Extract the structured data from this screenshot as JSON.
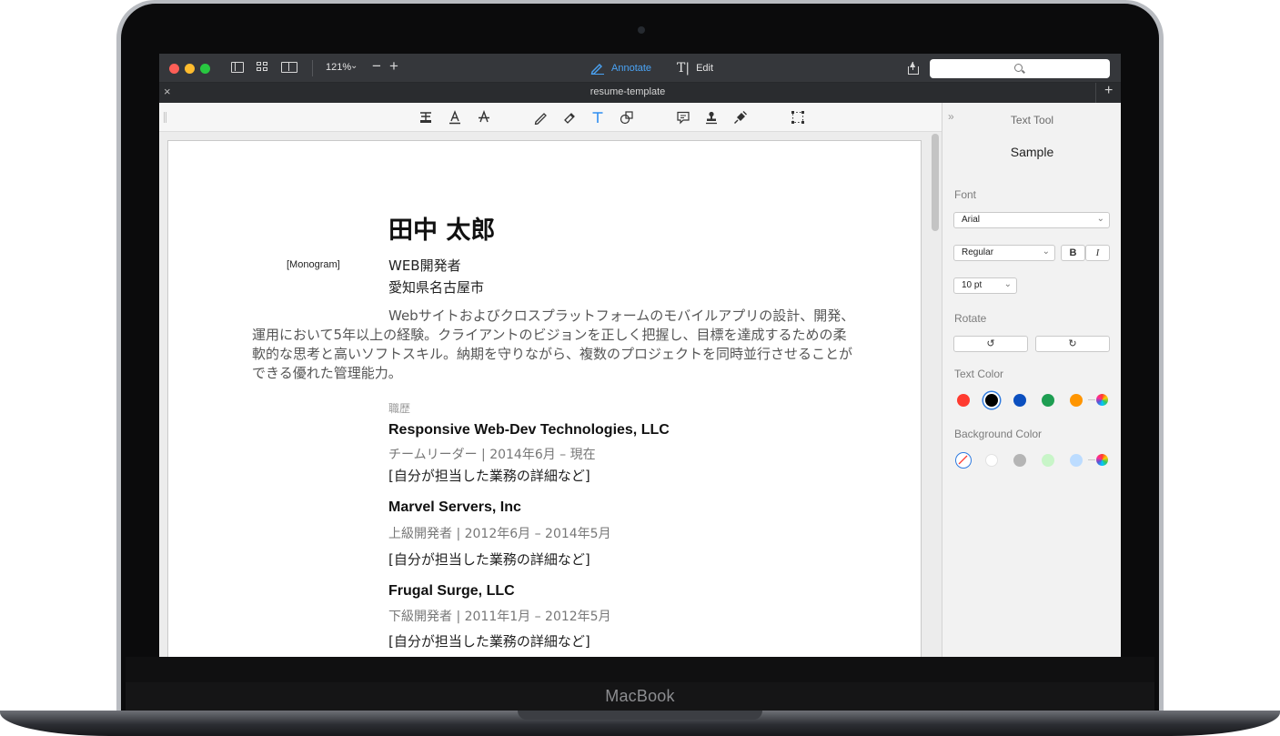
{
  "device": {
    "brand": "MacBook"
  },
  "toolbar": {
    "zoom_label": "121%",
    "zoom_chevron": "⌄",
    "zoom_out": "−",
    "zoom_in": "+",
    "annotate_label": "Annotate",
    "edit_label": "Edit",
    "edit_glyph": "T|"
  },
  "tab": {
    "title": "resume-template",
    "close": "×",
    "add": "+"
  },
  "document": {
    "name": "田中 太郎",
    "monogram": "[Monogram]",
    "role": "WEB開発者",
    "location": "愛知県名古屋市",
    "summary": "Webサイトおよびクロスプラットフォームのモバイルアプリの設計、開発、運用において5年以上の経験。クライアントのビジョンを正しく把握し、目標を達成するための柔軟的な思考と高いソフトスキル。納期を守りながら、複数のプロジェクトを同時並行させることができる優れた管理能力。",
    "section_title": "職歴",
    "jobs": [
      {
        "company": "Responsive Web-Dev Technologies, LLC",
        "meta": "チームリーダー | 2014年6月 – 現在",
        "desc": "[自分が担当した業務の詳細など]"
      },
      {
        "company": "Marvel Servers, Inc",
        "meta": "上級開発者 | 2012年6月 – 2014年5月",
        "desc": "[自分が担当した業務の詳細など]"
      },
      {
        "company": "Frugal Surge, LLC",
        "meta": "下級開発者 | 2011年1月 – 2012年5月",
        "desc": "[自分が担当した業務の詳細など]"
      }
    ]
  },
  "panel": {
    "collapse": "»",
    "title": "Text Tool",
    "sample": "Sample",
    "font_label": "Font",
    "font_value": "Arial",
    "style_value": "Regular",
    "bold": "B",
    "italic": "I",
    "size_value": "10 pt",
    "rotate_label": "Rotate",
    "rotate_left": "↺",
    "rotate_right": "↻",
    "text_color_label": "Text Color",
    "background_color_label": "Background Color",
    "text_colors": [
      "#ff3b30",
      "#000000",
      "#0b4fbf",
      "#1e9e52",
      "#ff9500"
    ],
    "background_colors": [
      "none",
      "#ffffff",
      "#b5b5b5",
      "#c8f5c8",
      "#bcdcff"
    ]
  },
  "colors": {
    "accent": "#4aa3f5",
    "toolbar_bg": "#35373b"
  }
}
